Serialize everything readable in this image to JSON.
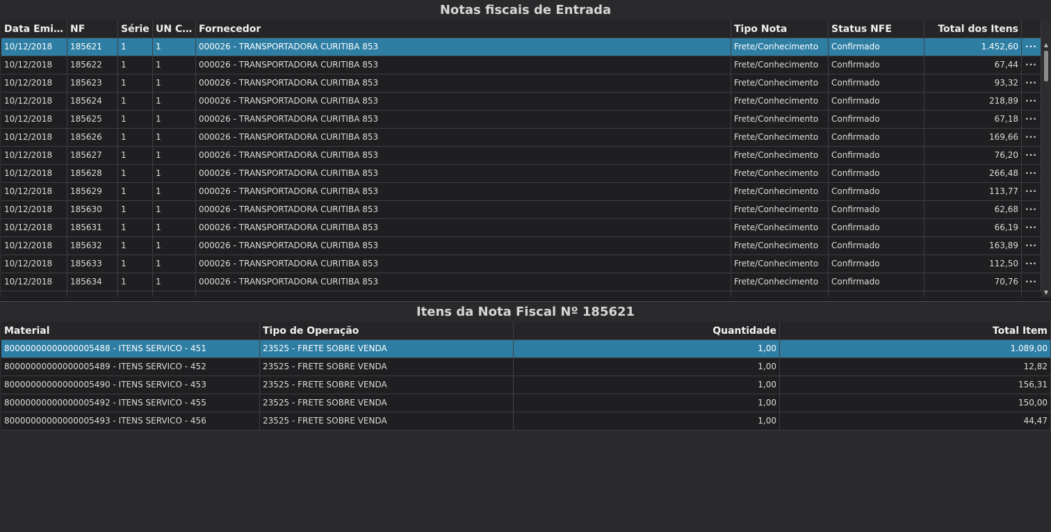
{
  "top": {
    "title": "Notas fiscais de Entrada",
    "columns": [
      "Data Emis...",
      "NF",
      "Série",
      "UN Cód",
      "Fornecedor",
      "Tipo Nota",
      "Status NFE",
      "Total dos Itens"
    ],
    "rows": [
      [
        "10/12/2018",
        "185621",
        "1",
        "1",
        "000026 - TRANSPORTADORA CURITIBA 853",
        "Frete/Conhecimento",
        "Confirmado",
        "1.452,60"
      ],
      [
        "10/12/2018",
        "185622",
        "1",
        "1",
        "000026 - TRANSPORTADORA CURITIBA 853",
        "Frete/Conhecimento",
        "Confirmado",
        "67,44"
      ],
      [
        "10/12/2018",
        "185623",
        "1",
        "1",
        "000026 - TRANSPORTADORA CURITIBA 853",
        "Frete/Conhecimento",
        "Confirmado",
        "93,32"
      ],
      [
        "10/12/2018",
        "185624",
        "1",
        "1",
        "000026 - TRANSPORTADORA CURITIBA 853",
        "Frete/Conhecimento",
        "Confirmado",
        "218,89"
      ],
      [
        "10/12/2018",
        "185625",
        "1",
        "1",
        "000026 - TRANSPORTADORA CURITIBA 853",
        "Frete/Conhecimento",
        "Confirmado",
        "67,18"
      ],
      [
        "10/12/2018",
        "185626",
        "1",
        "1",
        "000026 - TRANSPORTADORA CURITIBA 853",
        "Frete/Conhecimento",
        "Confirmado",
        "169,66"
      ],
      [
        "10/12/2018",
        "185627",
        "1",
        "1",
        "000026 - TRANSPORTADORA CURITIBA 853",
        "Frete/Conhecimento",
        "Confirmado",
        "76,20"
      ],
      [
        "10/12/2018",
        "185628",
        "1",
        "1",
        "000026 - TRANSPORTADORA CURITIBA 853",
        "Frete/Conhecimento",
        "Confirmado",
        "266,48"
      ],
      [
        "10/12/2018",
        "185629",
        "1",
        "1",
        "000026 - TRANSPORTADORA CURITIBA 853",
        "Frete/Conhecimento",
        "Confirmado",
        "113,77"
      ],
      [
        "10/12/2018",
        "185630",
        "1",
        "1",
        "000026 - TRANSPORTADORA CURITIBA 853",
        "Frete/Conhecimento",
        "Confirmado",
        "62,68"
      ],
      [
        "10/12/2018",
        "185631",
        "1",
        "1",
        "000026 - TRANSPORTADORA CURITIBA 853",
        "Frete/Conhecimento",
        "Confirmado",
        "66,19"
      ],
      [
        "10/12/2018",
        "185632",
        "1",
        "1",
        "000026 - TRANSPORTADORA CURITIBA 853",
        "Frete/Conhecimento",
        "Confirmado",
        "163,89"
      ],
      [
        "10/12/2018",
        "185633",
        "1",
        "1",
        "000026 - TRANSPORTADORA CURITIBA 853",
        "Frete/Conhecimento",
        "Confirmado",
        "112,50"
      ],
      [
        "10/12/2018",
        "185634",
        "1",
        "1",
        "000026 - TRANSPORTADORA CURITIBA 853",
        "Frete/Conhecimento",
        "Confirmado",
        "70,76"
      ]
    ],
    "selected_row": 0,
    "more_icon": "more-horizontal-icon",
    "more_glyph": "···"
  },
  "bottom": {
    "title": "Itens da Nota Fiscal Nº 185621",
    "columns": [
      "Material",
      "Tipo de Operação",
      "Quantidade",
      "Total Item"
    ],
    "rows": [
      [
        "80000000000000005488 - ITENS SERVICO -    451",
        "23525 - FRETE SOBRE VENDA",
        "1,00",
        "1.089,00"
      ],
      [
        "80000000000000005489 - ITENS SERVICO -    452",
        "23525 - FRETE SOBRE VENDA",
        "1,00",
        "12,82"
      ],
      [
        "80000000000000005490 - ITENS SERVICO -    453",
        "23525 - FRETE SOBRE VENDA",
        "1,00",
        "156,31"
      ],
      [
        "80000000000000005492 - ITENS SERVICO -    455",
        "23525 - FRETE SOBRE VENDA",
        "1,00",
        "150,00"
      ],
      [
        "80000000000000005493 - ITENS SERVICO -    456",
        "23525 - FRETE SOBRE VENDA",
        "1,00",
        "44,47"
      ]
    ],
    "selected_row": 0
  },
  "colors": {
    "background": "#2a2a2c",
    "row": "#1f1f21",
    "selected_row": "#2e7ea4",
    "grid_line": "#3f3f41"
  }
}
